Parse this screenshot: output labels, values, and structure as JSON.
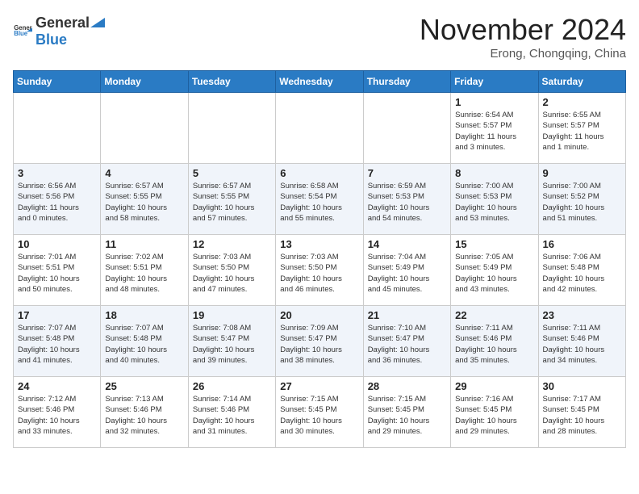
{
  "header": {
    "logo_general": "General",
    "logo_blue": "Blue",
    "month_title": "November 2024",
    "location": "Erong, Chongqing, China"
  },
  "weekdays": [
    "Sunday",
    "Monday",
    "Tuesday",
    "Wednesday",
    "Thursday",
    "Friday",
    "Saturday"
  ],
  "weeks": [
    [
      {
        "day": "",
        "info": ""
      },
      {
        "day": "",
        "info": ""
      },
      {
        "day": "",
        "info": ""
      },
      {
        "day": "",
        "info": ""
      },
      {
        "day": "",
        "info": ""
      },
      {
        "day": "1",
        "info": "Sunrise: 6:54 AM\nSunset: 5:57 PM\nDaylight: 11 hours\nand 3 minutes."
      },
      {
        "day": "2",
        "info": "Sunrise: 6:55 AM\nSunset: 5:57 PM\nDaylight: 11 hours\nand 1 minute."
      }
    ],
    [
      {
        "day": "3",
        "info": "Sunrise: 6:56 AM\nSunset: 5:56 PM\nDaylight: 11 hours\nand 0 minutes."
      },
      {
        "day": "4",
        "info": "Sunrise: 6:57 AM\nSunset: 5:55 PM\nDaylight: 10 hours\nand 58 minutes."
      },
      {
        "day": "5",
        "info": "Sunrise: 6:57 AM\nSunset: 5:55 PM\nDaylight: 10 hours\nand 57 minutes."
      },
      {
        "day": "6",
        "info": "Sunrise: 6:58 AM\nSunset: 5:54 PM\nDaylight: 10 hours\nand 55 minutes."
      },
      {
        "day": "7",
        "info": "Sunrise: 6:59 AM\nSunset: 5:53 PM\nDaylight: 10 hours\nand 54 minutes."
      },
      {
        "day": "8",
        "info": "Sunrise: 7:00 AM\nSunset: 5:53 PM\nDaylight: 10 hours\nand 53 minutes."
      },
      {
        "day": "9",
        "info": "Sunrise: 7:00 AM\nSunset: 5:52 PM\nDaylight: 10 hours\nand 51 minutes."
      }
    ],
    [
      {
        "day": "10",
        "info": "Sunrise: 7:01 AM\nSunset: 5:51 PM\nDaylight: 10 hours\nand 50 minutes."
      },
      {
        "day": "11",
        "info": "Sunrise: 7:02 AM\nSunset: 5:51 PM\nDaylight: 10 hours\nand 48 minutes."
      },
      {
        "day": "12",
        "info": "Sunrise: 7:03 AM\nSunset: 5:50 PM\nDaylight: 10 hours\nand 47 minutes."
      },
      {
        "day": "13",
        "info": "Sunrise: 7:03 AM\nSunset: 5:50 PM\nDaylight: 10 hours\nand 46 minutes."
      },
      {
        "day": "14",
        "info": "Sunrise: 7:04 AM\nSunset: 5:49 PM\nDaylight: 10 hours\nand 45 minutes."
      },
      {
        "day": "15",
        "info": "Sunrise: 7:05 AM\nSunset: 5:49 PM\nDaylight: 10 hours\nand 43 minutes."
      },
      {
        "day": "16",
        "info": "Sunrise: 7:06 AM\nSunset: 5:48 PM\nDaylight: 10 hours\nand 42 minutes."
      }
    ],
    [
      {
        "day": "17",
        "info": "Sunrise: 7:07 AM\nSunset: 5:48 PM\nDaylight: 10 hours\nand 41 minutes."
      },
      {
        "day": "18",
        "info": "Sunrise: 7:07 AM\nSunset: 5:48 PM\nDaylight: 10 hours\nand 40 minutes."
      },
      {
        "day": "19",
        "info": "Sunrise: 7:08 AM\nSunset: 5:47 PM\nDaylight: 10 hours\nand 39 minutes."
      },
      {
        "day": "20",
        "info": "Sunrise: 7:09 AM\nSunset: 5:47 PM\nDaylight: 10 hours\nand 38 minutes."
      },
      {
        "day": "21",
        "info": "Sunrise: 7:10 AM\nSunset: 5:47 PM\nDaylight: 10 hours\nand 36 minutes."
      },
      {
        "day": "22",
        "info": "Sunrise: 7:11 AM\nSunset: 5:46 PM\nDaylight: 10 hours\nand 35 minutes."
      },
      {
        "day": "23",
        "info": "Sunrise: 7:11 AM\nSunset: 5:46 PM\nDaylight: 10 hours\nand 34 minutes."
      }
    ],
    [
      {
        "day": "24",
        "info": "Sunrise: 7:12 AM\nSunset: 5:46 PM\nDaylight: 10 hours\nand 33 minutes."
      },
      {
        "day": "25",
        "info": "Sunrise: 7:13 AM\nSunset: 5:46 PM\nDaylight: 10 hours\nand 32 minutes."
      },
      {
        "day": "26",
        "info": "Sunrise: 7:14 AM\nSunset: 5:46 PM\nDaylight: 10 hours\nand 31 minutes."
      },
      {
        "day": "27",
        "info": "Sunrise: 7:15 AM\nSunset: 5:45 PM\nDaylight: 10 hours\nand 30 minutes."
      },
      {
        "day": "28",
        "info": "Sunrise: 7:15 AM\nSunset: 5:45 PM\nDaylight: 10 hours\nand 29 minutes."
      },
      {
        "day": "29",
        "info": "Sunrise: 7:16 AM\nSunset: 5:45 PM\nDaylight: 10 hours\nand 29 minutes."
      },
      {
        "day": "30",
        "info": "Sunrise: 7:17 AM\nSunset: 5:45 PM\nDaylight: 10 hours\nand 28 minutes."
      }
    ]
  ]
}
